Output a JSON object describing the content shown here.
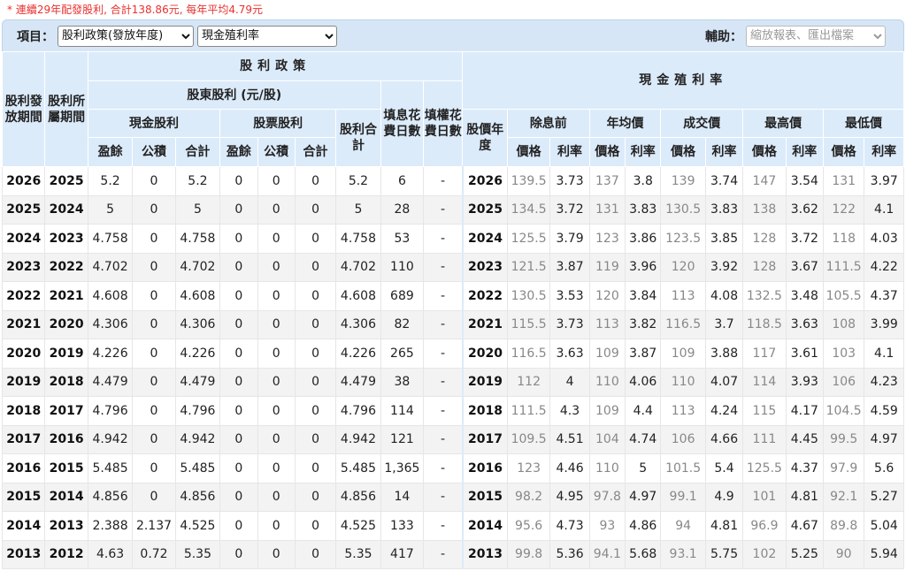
{
  "note": "* 連續29年配發股利, 合計138.86元, 每年平均4.79元",
  "toolbar": {
    "item_label": "項目：",
    "policy_select": "股利政策(發放年度)",
    "yield_select": "現金殖利率",
    "aux_label": "輔助：",
    "aux_select": "縮放報表、匯出檔案"
  },
  "headers": {
    "issue_period": "股利發放期間",
    "belong_period": "股利所屬期間",
    "policy": "股利政策",
    "shareholder": "股東股利 (元/股)",
    "cash_div": "現金股利",
    "stock_div": "股票股利",
    "total_div": "股利合計",
    "fill_div": "填息花費日數",
    "fill_right": "填權花費日數",
    "yield": "現金殖利率",
    "price_year": "股價年度",
    "ex_before": "除息前",
    "avg_price": "年均價",
    "close_price": "成交價",
    "high_price": "最高價",
    "low_price": "最低價",
    "earn": "盈餘",
    "reserve": "公積",
    "sum": "合計",
    "price": "價格",
    "rate": "利率"
  },
  "rows": [
    {
      "y": "2026",
      "b": "2025",
      "ce": "5.2",
      "cr": "0",
      "ct": "5.2",
      "se": "0",
      "sr": "0",
      "st": "0",
      "t": "5.2",
      "fd": "6",
      "fr": "-",
      "py": "2026",
      "p1": "139.5",
      "r1": "3.73",
      "p2": "137",
      "r2": "3.8",
      "p3": "139",
      "r3": "3.74",
      "p4": "147",
      "r4": "3.54",
      "p5": "131",
      "r5": "3.97"
    },
    {
      "y": "2025",
      "b": "2024",
      "ce": "5",
      "cr": "0",
      "ct": "5",
      "se": "0",
      "sr": "0",
      "st": "0",
      "t": "5",
      "fd": "28",
      "fr": "-",
      "py": "2025",
      "p1": "134.5",
      "r1": "3.72",
      "p2": "131",
      "r2": "3.83",
      "p3": "130.5",
      "r3": "3.83",
      "p4": "138",
      "r4": "3.62",
      "p5": "122",
      "r5": "4.1"
    },
    {
      "y": "2024",
      "b": "2023",
      "ce": "4.758",
      "cr": "0",
      "ct": "4.758",
      "se": "0",
      "sr": "0",
      "st": "0",
      "t": "4.758",
      "fd": "53",
      "fr": "-",
      "py": "2024",
      "p1": "125.5",
      "r1": "3.79",
      "p2": "123",
      "r2": "3.86",
      "p3": "123.5",
      "r3": "3.85",
      "p4": "128",
      "r4": "3.72",
      "p5": "118",
      "r5": "4.03"
    },
    {
      "y": "2023",
      "b": "2022",
      "ce": "4.702",
      "cr": "0",
      "ct": "4.702",
      "se": "0",
      "sr": "0",
      "st": "0",
      "t": "4.702",
      "fd": "110",
      "fr": "-",
      "py": "2023",
      "p1": "121.5",
      "r1": "3.87",
      "p2": "119",
      "r2": "3.96",
      "p3": "120",
      "r3": "3.92",
      "p4": "128",
      "r4": "3.67",
      "p5": "111.5",
      "r5": "4.22"
    },
    {
      "y": "2022",
      "b": "2021",
      "ce": "4.608",
      "cr": "0",
      "ct": "4.608",
      "se": "0",
      "sr": "0",
      "st": "0",
      "t": "4.608",
      "fd": "689",
      "fr": "-",
      "py": "2022",
      "p1": "130.5",
      "r1": "3.53",
      "p2": "120",
      "r2": "3.84",
      "p3": "113",
      "r3": "4.08",
      "p4": "132.5",
      "r4": "3.48",
      "p5": "105.5",
      "r5": "4.37"
    },
    {
      "y": "2021",
      "b": "2020",
      "ce": "4.306",
      "cr": "0",
      "ct": "4.306",
      "se": "0",
      "sr": "0",
      "st": "0",
      "t": "4.306",
      "fd": "82",
      "fr": "-",
      "py": "2021",
      "p1": "115.5",
      "r1": "3.73",
      "p2": "113",
      "r2": "3.82",
      "p3": "116.5",
      "r3": "3.7",
      "p4": "118.5",
      "r4": "3.63",
      "p5": "108",
      "r5": "3.99"
    },
    {
      "y": "2020",
      "b": "2019",
      "ce": "4.226",
      "cr": "0",
      "ct": "4.226",
      "se": "0",
      "sr": "0",
      "st": "0",
      "t": "4.226",
      "fd": "265",
      "fr": "-",
      "py": "2020",
      "p1": "116.5",
      "r1": "3.63",
      "p2": "109",
      "r2": "3.87",
      "p3": "109",
      "r3": "3.88",
      "p4": "117",
      "r4": "3.61",
      "p5": "103",
      "r5": "4.1"
    },
    {
      "y": "2019",
      "b": "2018",
      "ce": "4.479",
      "cr": "0",
      "ct": "4.479",
      "se": "0",
      "sr": "0",
      "st": "0",
      "t": "4.479",
      "fd": "38",
      "fr": "-",
      "py": "2019",
      "p1": "112",
      "r1": "4",
      "p2": "110",
      "r2": "4.06",
      "p3": "110",
      "r3": "4.07",
      "p4": "114",
      "r4": "3.93",
      "p5": "106",
      "r5": "4.23"
    },
    {
      "y": "2018",
      "b": "2017",
      "ce": "4.796",
      "cr": "0",
      "ct": "4.796",
      "se": "0",
      "sr": "0",
      "st": "0",
      "t": "4.796",
      "fd": "114",
      "fr": "-",
      "py": "2018",
      "p1": "111.5",
      "r1": "4.3",
      "p2": "109",
      "r2": "4.4",
      "p3": "113",
      "r3": "4.24",
      "p4": "115",
      "r4": "4.17",
      "p5": "104.5",
      "r5": "4.59"
    },
    {
      "y": "2017",
      "b": "2016",
      "ce": "4.942",
      "cr": "0",
      "ct": "4.942",
      "se": "0",
      "sr": "0",
      "st": "0",
      "t": "4.942",
      "fd": "121",
      "fr": "-",
      "py": "2017",
      "p1": "109.5",
      "r1": "4.51",
      "p2": "104",
      "r2": "4.74",
      "p3": "106",
      "r3": "4.66",
      "p4": "111",
      "r4": "4.45",
      "p5": "99.5",
      "r5": "4.97"
    },
    {
      "y": "2016",
      "b": "2015",
      "ce": "5.485",
      "cr": "0",
      "ct": "5.485",
      "se": "0",
      "sr": "0",
      "st": "0",
      "t": "5.485",
      "fd": "1,365",
      "fr": "-",
      "py": "2016",
      "p1": "123",
      "r1": "4.46",
      "p2": "110",
      "r2": "5",
      "p3": "101.5",
      "r3": "5.4",
      "p4": "125.5",
      "r4": "4.37",
      "p5": "97.9",
      "r5": "5.6"
    },
    {
      "y": "2015",
      "b": "2014",
      "ce": "4.856",
      "cr": "0",
      "ct": "4.856",
      "se": "0",
      "sr": "0",
      "st": "0",
      "t": "4.856",
      "fd": "14",
      "fr": "-",
      "py": "2015",
      "p1": "98.2",
      "r1": "4.95",
      "p2": "97.8",
      "r2": "4.97",
      "p3": "99.1",
      "r3": "4.9",
      "p4": "101",
      "r4": "4.81",
      "p5": "92.1",
      "r5": "5.27"
    },
    {
      "y": "2014",
      "b": "2013",
      "ce": "2.388",
      "cr": "2.137",
      "ct": "4.525",
      "se": "0",
      "sr": "0",
      "st": "0",
      "t": "4.525",
      "fd": "133",
      "fr": "-",
      "py": "2014",
      "p1": "95.6",
      "r1": "4.73",
      "p2": "93",
      "r2": "4.86",
      "p3": "94",
      "r3": "4.81",
      "p4": "96.9",
      "r4": "4.67",
      "p5": "89.8",
      "r5": "5.04"
    },
    {
      "y": "2013",
      "b": "2012",
      "ce": "4.63",
      "cr": "0.72",
      "ct": "5.35",
      "se": "0",
      "sr": "0",
      "st": "0",
      "t": "5.35",
      "fd": "417",
      "fr": "-",
      "py": "2013",
      "p1": "99.8",
      "r1": "5.36",
      "p2": "94.1",
      "r2": "5.68",
      "p3": "93.1",
      "r3": "5.75",
      "p4": "102",
      "r4": "5.25",
      "p5": "90",
      "r5": "5.94"
    }
  ]
}
